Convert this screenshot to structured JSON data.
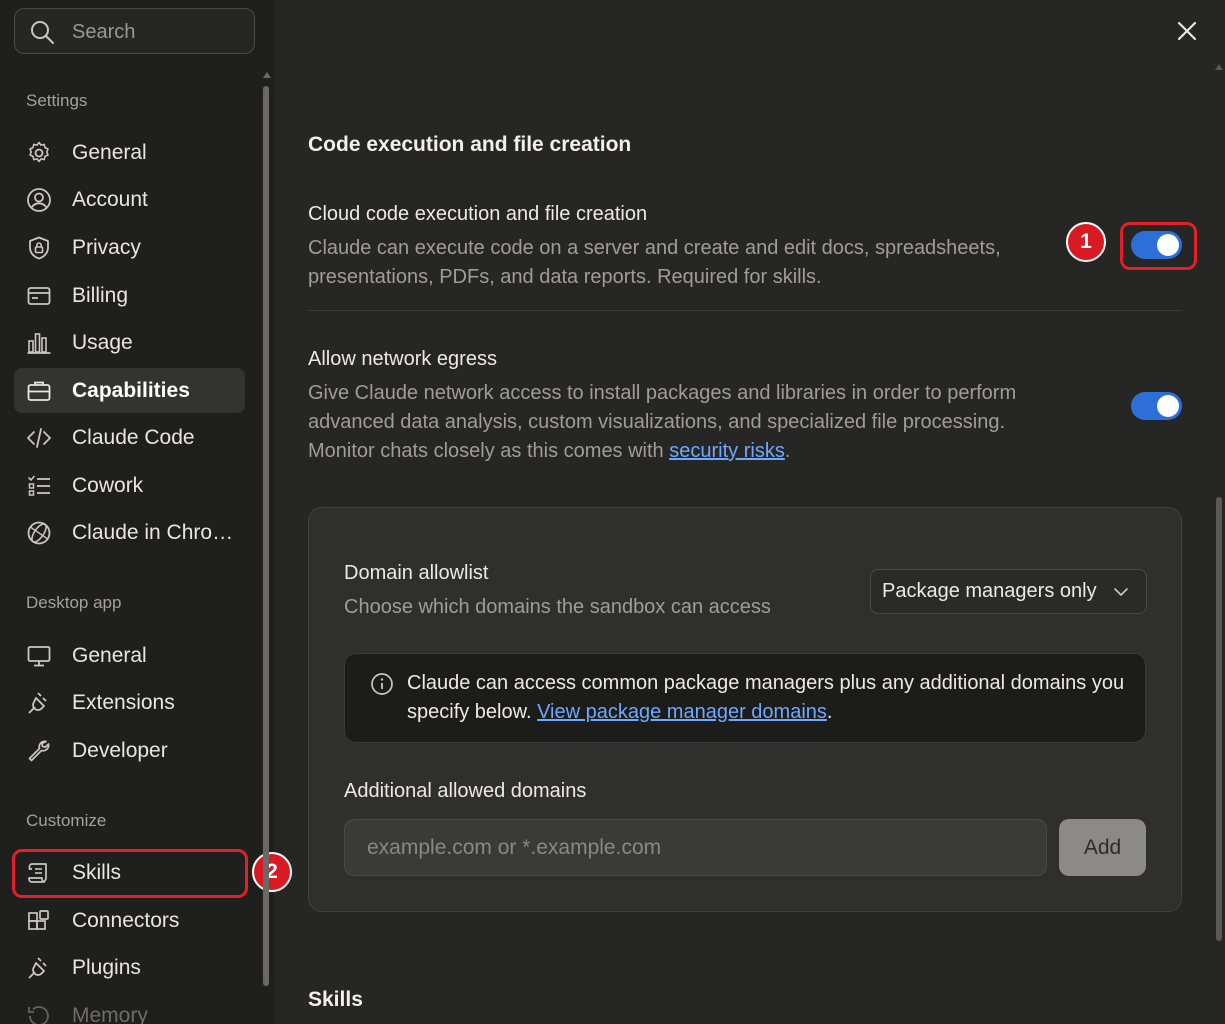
{
  "sidebar": {
    "search_placeholder": "Search",
    "sections": {
      "settings": "Settings",
      "desktop_app": "Desktop app",
      "customize": "Customize"
    },
    "settings_items": [
      {
        "label": "General",
        "icon": "gear-icon"
      },
      {
        "label": "Account",
        "icon": "user-circle-icon"
      },
      {
        "label": "Privacy",
        "icon": "shield-lock-icon"
      },
      {
        "label": "Billing",
        "icon": "credit-card-icon"
      },
      {
        "label": "Usage",
        "icon": "bar-chart-icon"
      },
      {
        "label": "Capabilities",
        "icon": "briefcase-icon",
        "active": true
      },
      {
        "label": "Claude Code",
        "icon": "code-icon"
      },
      {
        "label": "Cowork",
        "icon": "checklist-icon"
      },
      {
        "label": "Claude in Chro…",
        "icon": "globe-icon"
      }
    ],
    "desktop_items": [
      {
        "label": "General",
        "icon": "monitor-icon"
      },
      {
        "label": "Extensions",
        "icon": "plug-icon"
      },
      {
        "label": "Developer",
        "icon": "wrench-icon"
      }
    ],
    "customize_items": [
      {
        "label": "Skills",
        "icon": "scroll-icon"
      },
      {
        "label": "Connectors",
        "icon": "blocks-icon"
      },
      {
        "label": "Plugins",
        "icon": "plug-icon"
      },
      {
        "label": "Memory",
        "icon": "memory-icon"
      }
    ]
  },
  "annotations": {
    "badge_1": "1",
    "badge_2": "2"
  },
  "main": {
    "section_title": "Code execution and file creation",
    "cloud": {
      "title": "Cloud code execution and file creation",
      "description": "Claude can execute code on a server and create and edit docs, spreadsheets, presentations, PDFs, and data reports. Required for skills.",
      "enabled": true
    },
    "egress": {
      "title": "Allow network egress",
      "description": "Give Claude network access to install packages and libraries in order to perform advanced data analysis, custom visualizations, and specialized file processing. Monitor chats closely as this comes with ",
      "link": "security risks",
      "description_end": ".",
      "enabled": true
    },
    "domain_allowlist": {
      "title": "Domain allowlist",
      "description": "Choose which domains the sandbox can access",
      "selected": "Package managers only",
      "info_text": "Claude can access common package managers plus any additional domains you specify below. ",
      "info_link": "View package manager domains",
      "info_end": "."
    },
    "additional": {
      "label": "Additional allowed domains",
      "placeholder": "example.com or *.example.com",
      "add_button": "Add"
    },
    "skills_title": "Skills"
  },
  "colors": {
    "accent_toggle": "#2d6fd8",
    "highlight_red": "#e0202a",
    "link": "#6fa8ff"
  }
}
